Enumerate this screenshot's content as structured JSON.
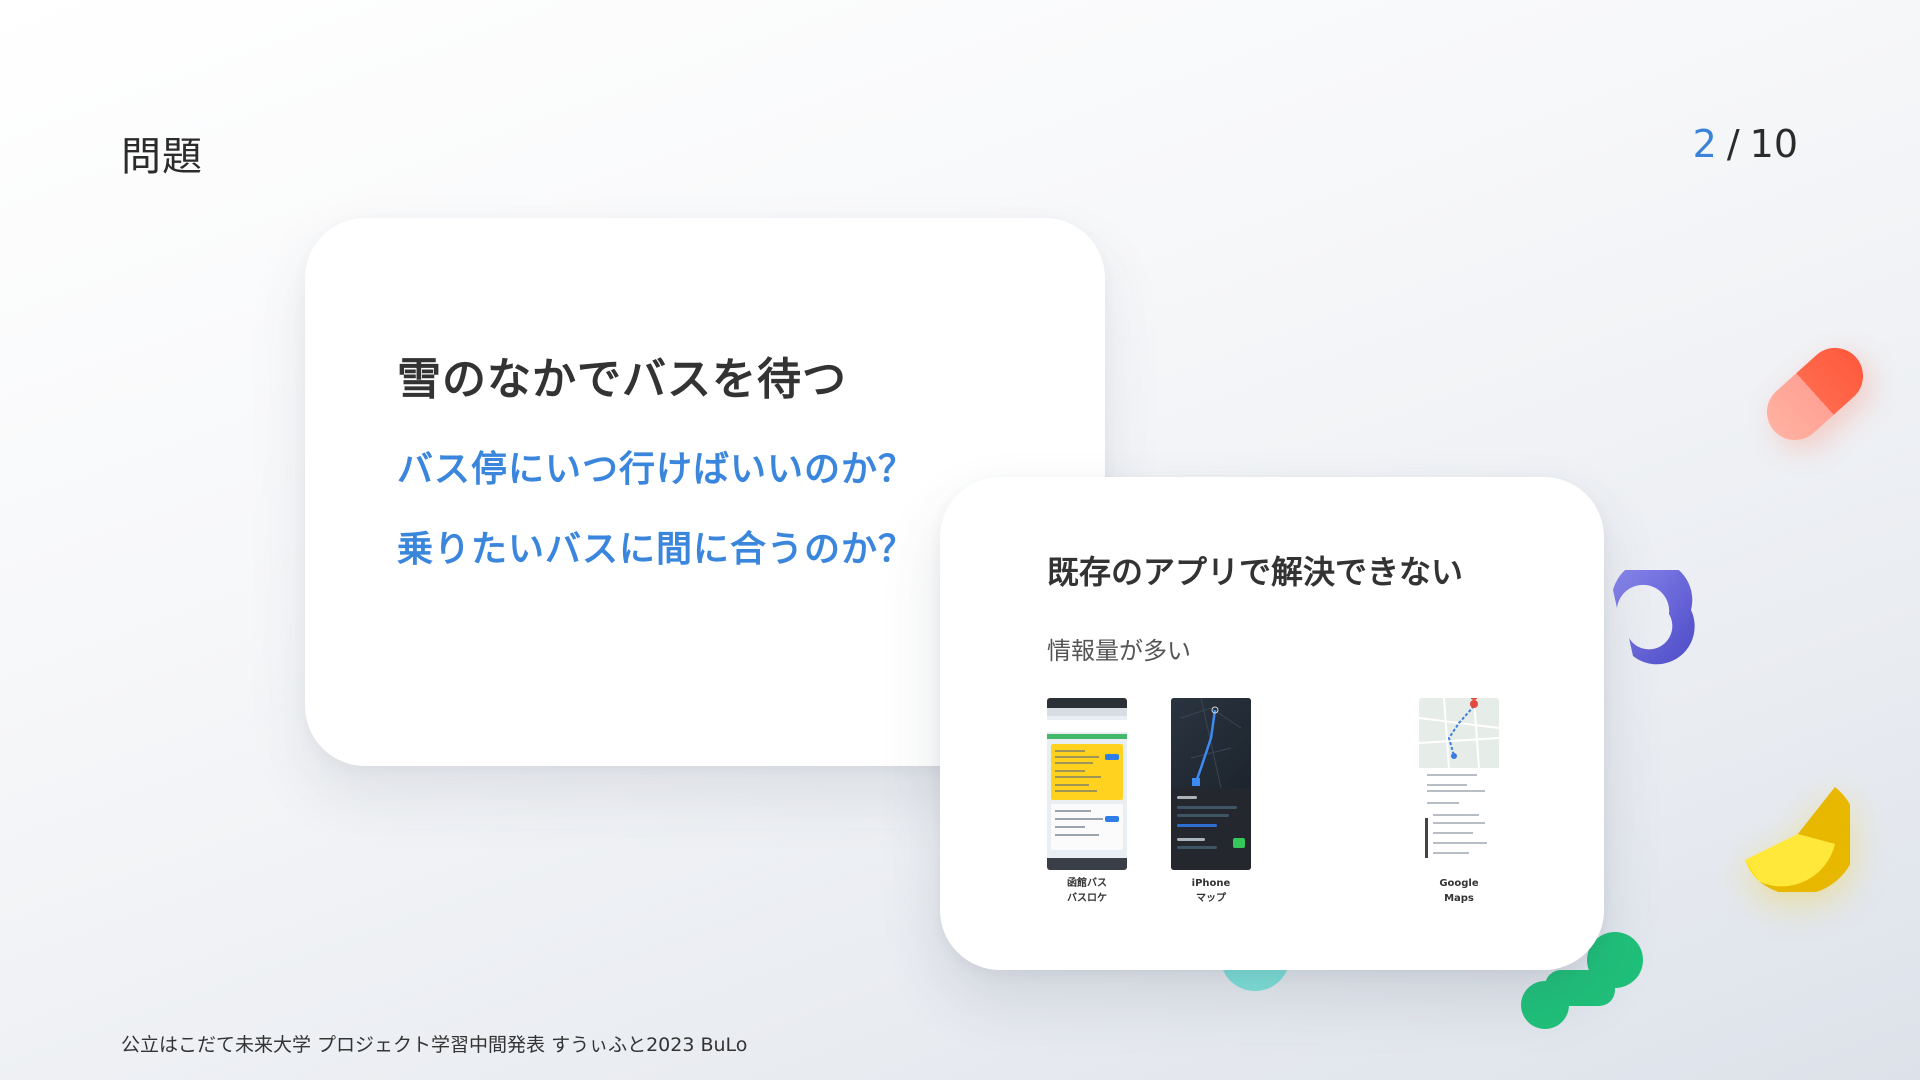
{
  "slide": {
    "title": "問題",
    "page_current": "2",
    "page_separator": "/",
    "page_total": "10"
  },
  "main_card": {
    "heading": "雪のなかでバスを待つ",
    "questions": [
      "バス停にいつ行けばいいのか？",
      "乗りたいバスに間に合うのか？"
    ]
  },
  "apps_card": {
    "heading": "既存のアプリで解決できない",
    "subheading": "情報量が多い",
    "apps": [
      {
        "line1": "函館バス",
        "line2": "バスロケ",
        "icon": "bus-locator-screenshot"
      },
      {
        "line1": "iPhone",
        "line2": "マップ",
        "icon": "iphone-maps-screenshot"
      },
      {
        "line1": "Google",
        "line2": "Maps",
        "icon": "google-maps-screenshot"
      }
    ]
  },
  "footer": {
    "text": "公立はこだて未来大学 プロジェクト学習中間発表 すうぃふと2023 BuLo"
  },
  "colors": {
    "accent_blue": "#3b86dd",
    "text_dark": "#333333",
    "deco_red": "#ff5a3d",
    "deco_purple": "#5f5cd6",
    "deco_yellow": "#ffd800",
    "deco_green": "#1fc17a"
  }
}
